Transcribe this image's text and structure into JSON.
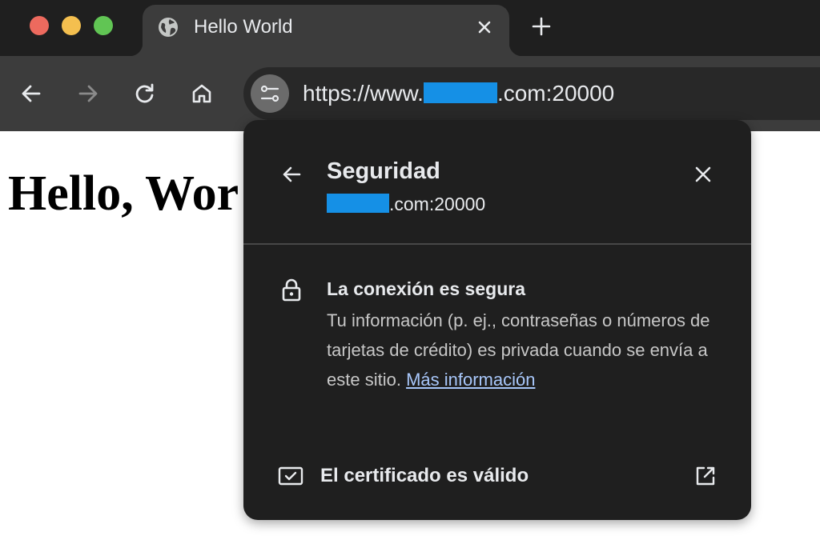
{
  "tab": {
    "title": "Hello World",
    "favicon": "globe-icon"
  },
  "toolbar": {
    "back": "back-arrow-icon",
    "forward": "forward-arrow-icon",
    "reload": "reload-icon",
    "home": "home-icon",
    "site_info": "tune-icon",
    "url_prefix": "https://www.",
    "url_suffix": ".com:20000"
  },
  "page": {
    "heading": "Hello, Wor"
  },
  "security_bubble": {
    "title": "Seguridad",
    "subtitle_suffix": ".com:20000",
    "connection_title": "La conexión es segura",
    "connection_desc": "Tu información (p. ej., contraseñas o números de tarjetas de crédito) es privada cuando se envía a este sitio.",
    "learn_more": "Más información",
    "certificate_label": "El certificado es válido"
  },
  "colors": {
    "tabstrip_bg": "#1f1f1f",
    "toolbar_bg": "#3c3c3c",
    "bubble_bg": "#1f1f1f",
    "link": "#a8c7fa",
    "redaction": "#1590e6",
    "traffic_close": "#ed6a5e",
    "traffic_min": "#f4bf4f",
    "traffic_max": "#61c554"
  }
}
